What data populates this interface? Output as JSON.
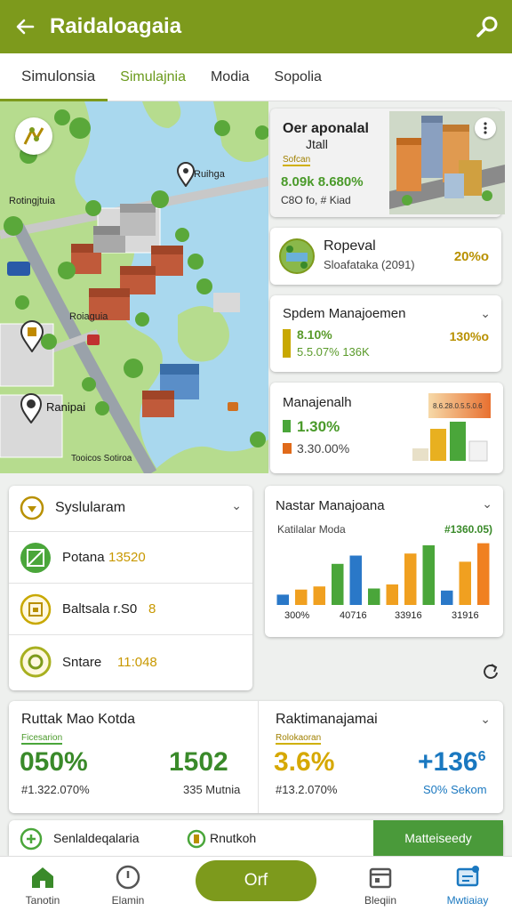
{
  "header": {
    "title": "Raidaloagaia"
  },
  "tabs": [
    {
      "label": "Simulonsia"
    },
    {
      "label": "Simulajnia"
    },
    {
      "label": "Modia"
    },
    {
      "label": "Sopolia"
    }
  ],
  "map": {
    "labels": [
      {
        "text": "Rotingjtuia"
      },
      {
        "text": "Ruihga"
      },
      {
        "text": "Roiaguia"
      },
      {
        "text": "Ranipai"
      },
      {
        "text": "Tooicos Sotiroa"
      }
    ]
  },
  "promo": {
    "title_line1": "Oer aponalal",
    "title_line2": "Jtall",
    "tag": "Sofcan",
    "value": "8.09k 8.680%",
    "sub": "C8O fo, # Kiad"
  },
  "proposal": {
    "title": "Ropeval",
    "sub": "Sloafataka (2091)",
    "value": "20%o"
  },
  "manage1": {
    "title": "Spdem Manajoemen",
    "row1": "8.10%",
    "row2": "5.5.07% 136K",
    "right": "130%o"
  },
  "manage2": {
    "title": "Manajenalh",
    "row1": "1.30%",
    "row2": "3.30.00%",
    "chart_label": "8.6.28.0.5.5.0.6"
  },
  "list_card": {
    "title": "Syslularam",
    "items": [
      {
        "label": "Potana",
        "value": "13520"
      },
      {
        "label": "Baltsala r.S0",
        "value": "8"
      },
      {
        "label": "Sntare",
        "value": "11:048"
      }
    ]
  },
  "chart_card": {
    "title": "Nastar Manajoana",
    "subtitle": "Katilalar Moda",
    "value": "#1360.05)",
    "ticks": [
      "300%",
      "40716",
      "33916",
      "31916"
    ]
  },
  "chart_data": {
    "type": "bar",
    "categories": [
      "1",
      "2",
      "3",
      "4",
      "5",
      "6",
      "7",
      "8",
      "9",
      "10",
      "11",
      "12"
    ],
    "values": [
      10,
      15,
      18,
      40,
      48,
      16,
      20,
      50,
      58,
      14,
      42,
      60
    ],
    "colors": [
      "#2a78c8",
      "#f0a020",
      "#f0a020",
      "#4aa63a",
      "#2a78c8",
      "#4aa63a",
      "#f0a020",
      "#f0a020",
      "#4aa63a",
      "#2a78c8",
      "#f0a020",
      "#f08020"
    ],
    "ylim": [
      0,
      64
    ]
  },
  "stats": {
    "left_title": "Ruttak Mao Kotda",
    "left_tag": "Ficesarion",
    "left_value1": "050%",
    "left_value2": "1502",
    "left_sub1": "#1.322.070%",
    "left_sub2": "335 Mutnia",
    "right_title": "Raktimanajamai",
    "right_tag": "Rolokaoran",
    "right_value1": "3.6%",
    "right_value2": "+136",
    "right_sup": "6",
    "right_sub1": "#13.2.070%",
    "right_sub2": "S0% Sekom"
  },
  "bottom_strip": {
    "item1": "Senlaldeqalaria",
    "item2": "Rnutkoh",
    "button": "Matteiseedy"
  },
  "nav": {
    "items": [
      "Tanotin",
      "Elamin",
      "Orf",
      "Bleqiin",
      "Mwtiaiay"
    ]
  },
  "colors": {
    "brand": "#7d9a1c",
    "green": "#4aa63a",
    "gold": "#d6a800",
    "blue": "#1a78c0",
    "orange": "#e06a1a"
  }
}
